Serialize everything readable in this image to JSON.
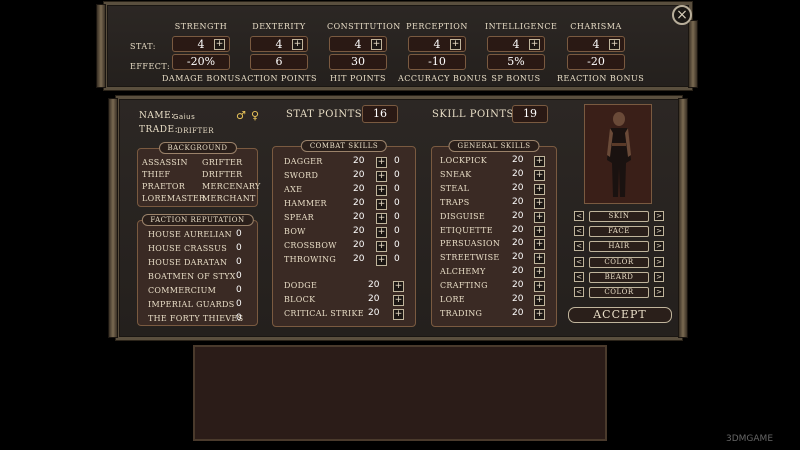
{
  "stats": [
    {
      "name": "STRENGTH",
      "value": "4",
      "effect": "-20%",
      "effect_label": "DAMAGE BONUS"
    },
    {
      "name": "DEXTERITY",
      "value": "4",
      "effect": "6",
      "effect_label": "ACTION POINTS"
    },
    {
      "name": "CONSTITUTION",
      "value": "4",
      "effect": "30",
      "effect_label": "HIT POINTS"
    },
    {
      "name": "PERCEPTION",
      "value": "4",
      "effect": "-10",
      "effect_label": "ACCURACY BONUS"
    },
    {
      "name": "INTELLIGENCE",
      "value": "4",
      "effect": "5%",
      "effect_label": "SP BONUS"
    },
    {
      "name": "CHARISMA",
      "value": "4",
      "effect": "-20",
      "effect_label": "REACTION BONUS"
    }
  ],
  "stat_row_label": "STAT:",
  "effect_row_label": "EFFECT:",
  "name_label": "NAME:",
  "name_value": "Gaius",
  "trade_label": "TRADE:",
  "trade_value": "DRIFTER",
  "male_symbol": "♂",
  "female_symbol": "♀",
  "stat_points_label": "STAT POINTS:",
  "stat_points": "16",
  "skill_points_label": "SKILL POINTS:",
  "skill_points": "19",
  "background": {
    "title": "BACKGROUND",
    "items": [
      "ASSASSIN",
      "GRIFTER",
      "THIEF",
      "DRIFTER",
      "PRAETOR",
      "MERCENARY",
      "LOREMASTER",
      "MERCHANT"
    ]
  },
  "faction": {
    "title": "FACTION REPUTATION",
    "items": [
      {
        "name": "HOUSE AURELIAN",
        "value": "0"
      },
      {
        "name": "HOUSE CRASSUS",
        "value": "0"
      },
      {
        "name": "HOUSE DARATAN",
        "value": "0"
      },
      {
        "name": "BOATMEN OF STYX",
        "value": "0"
      },
      {
        "name": "COMMERCIUM",
        "value": "0"
      },
      {
        "name": "IMPERIAL GUARDS",
        "value": "0"
      },
      {
        "name": "THE FORTY THIEVES",
        "value": "0"
      }
    ]
  },
  "combat": {
    "title": "COMBAT SKILLS",
    "items": [
      {
        "name": "DAGGER",
        "value": "20",
        "bonus": "0"
      },
      {
        "name": "SWORD",
        "value": "20",
        "bonus": "0"
      },
      {
        "name": "AXE",
        "value": "20",
        "bonus": "0"
      },
      {
        "name": "HAMMER",
        "value": "20",
        "bonus": "0"
      },
      {
        "name": "SPEAR",
        "value": "20",
        "bonus": "0"
      },
      {
        "name": "BOW",
        "value": "20",
        "bonus": "0"
      },
      {
        "name": "CROSSBOW",
        "value": "20",
        "bonus": "0"
      },
      {
        "name": "THROWING",
        "value": "20",
        "bonus": "0"
      }
    ],
    "defense": [
      {
        "name": "DODGE",
        "value": "20"
      },
      {
        "name": "BLOCK",
        "value": "20"
      },
      {
        "name": "CRITICAL STRIKE",
        "value": "20"
      }
    ]
  },
  "general": {
    "title": "GENERAL SKILLS",
    "items": [
      {
        "name": "LOCKPICK",
        "value": "20"
      },
      {
        "name": "SNEAK",
        "value": "20"
      },
      {
        "name": "STEAL",
        "value": "20"
      },
      {
        "name": "TRAPS",
        "value": "20"
      },
      {
        "name": "DISGUISE",
        "value": "20"
      },
      {
        "name": "ETIQUETTE",
        "value": "20"
      },
      {
        "name": "PERSUASION",
        "value": "20"
      },
      {
        "name": "STREETWISE",
        "value": "20"
      },
      {
        "name": "ALCHEMY",
        "value": "20"
      },
      {
        "name": "CRAFTING",
        "value": "20"
      },
      {
        "name": "LORE",
        "value": "20"
      },
      {
        "name": "TRADING",
        "value": "20"
      }
    ]
  },
  "customize": [
    "SKIN",
    "FACE",
    "HAIR",
    "COLOR",
    "BEARD",
    "COLOR"
  ],
  "accept_label": "ACCEPT",
  "plus_glyph": "+",
  "prev_glyph": "<",
  "next_glyph": ">",
  "close_glyph": "×",
  "watermark": "3DMGAME"
}
